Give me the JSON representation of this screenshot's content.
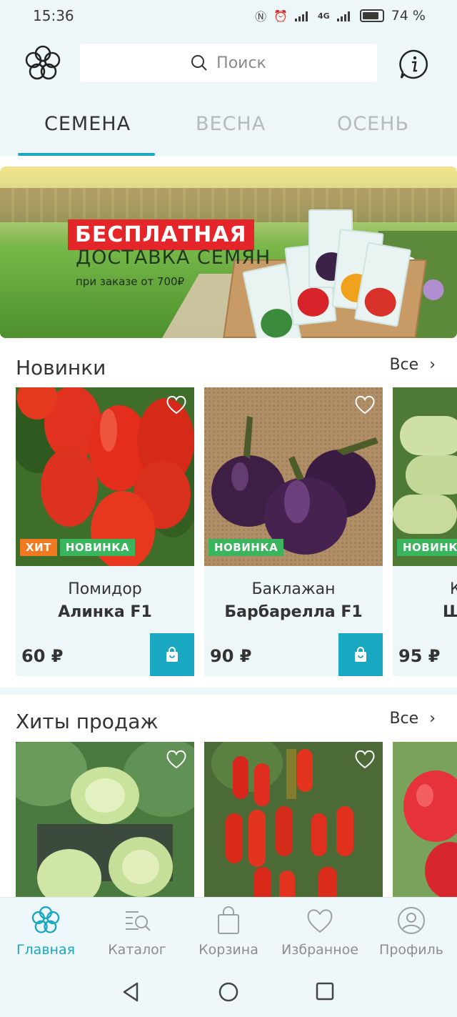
{
  "status_bar": {
    "time": "15:36",
    "network": "4G",
    "battery": "74 %"
  },
  "header": {
    "search_placeholder": "Поиск"
  },
  "tabs": [
    {
      "label": "СЕМЕНА",
      "active": true
    },
    {
      "label": "ВЕСНА",
      "active": false
    },
    {
      "label": "ОСЕНЬ",
      "active": false
    }
  ],
  "banner": {
    "headline": "БЕСПЛАТНАЯ",
    "subline": "ДОСТАВКА СЕМЯН",
    "note": "при заказе от 700₽"
  },
  "sections": {
    "new": {
      "title": "Новинки",
      "see_all": "Все",
      "products": [
        {
          "name1": "Помидор",
          "name2": "Алинка F1",
          "price": "60 ₽",
          "badges": [
            "ХИТ",
            "НОВИНКА"
          ]
        },
        {
          "name1": "Баклажан",
          "name2": "Барбарелла F1",
          "price": "90 ₽",
          "badges": [
            "НОВИНКА"
          ]
        },
        {
          "name1": "К",
          "name2": "Ш",
          "price": "95 ₽",
          "badges": [
            "НОВИНКА"
          ]
        }
      ]
    },
    "hits": {
      "title": "Хиты продаж",
      "see_all": "Все"
    }
  },
  "bottom_nav": [
    {
      "label": "Главная",
      "icon": "flower-icon",
      "active": true
    },
    {
      "label": "Каталог",
      "icon": "catalog-search-icon",
      "active": false
    },
    {
      "label": "Корзина",
      "icon": "shopping-bag-icon",
      "active": false
    },
    {
      "label": "Избранное",
      "icon": "heart-icon",
      "active": false
    },
    {
      "label": "Профиль",
      "icon": "profile-icon",
      "active": false
    }
  ],
  "colors": {
    "accent": "#1aa7c2",
    "hit_badge": "#f07a22",
    "new_badge": "#3bb55d",
    "promo_red": "#e4262b"
  }
}
